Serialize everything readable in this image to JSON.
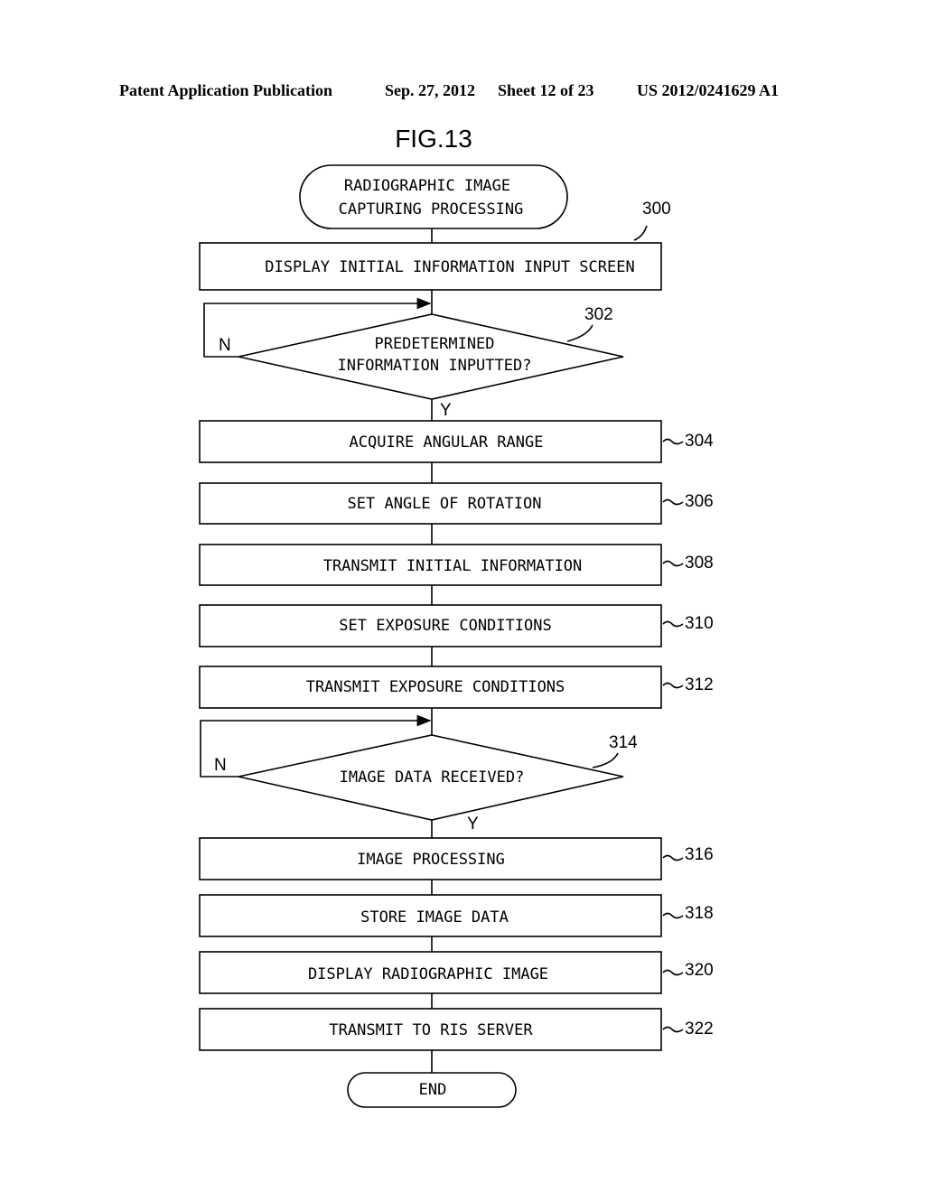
{
  "header": {
    "left": "Patent Application Publication",
    "date": "Sep. 27, 2012",
    "sheet": "Sheet 12 of 23",
    "number": "US 2012/0241629 A1"
  },
  "figure_title": "FIG.13",
  "start": {
    "line1": "RADIOGRAPHIC IMAGE",
    "line2": "CAPTURING PROCESSING"
  },
  "steps": [
    {
      "ref": "300",
      "label": "DISPLAY INITIAL INFORMATION INPUT SCREEN"
    },
    {
      "ref": "304",
      "label": "ACQUIRE ANGULAR RANGE"
    },
    {
      "ref": "306",
      "label": "SET ANGLE OF ROTATION"
    },
    {
      "ref": "308",
      "label": "TRANSMIT INITIAL INFORMATION"
    },
    {
      "ref": "310",
      "label": "SET EXPOSURE CONDITIONS"
    },
    {
      "ref": "312",
      "label": "TRANSMIT EXPOSURE CONDITIONS"
    },
    {
      "ref": "316",
      "label": "IMAGE PROCESSING"
    },
    {
      "ref": "318",
      "label": "STORE IMAGE DATA"
    },
    {
      "ref": "320",
      "label": "DISPLAY RADIOGRAPHIC IMAGE"
    },
    {
      "ref": "322",
      "label": "TRANSMIT TO RIS SERVER"
    }
  ],
  "decisions": [
    {
      "ref": "302",
      "line1": "PREDETERMINED",
      "line2": "INFORMATION INPUTTED?",
      "no": "N",
      "yes": "Y"
    },
    {
      "ref": "314",
      "line1": "IMAGE DATA RECEIVED?",
      "no": "N",
      "yes": "Y"
    }
  ],
  "end": "END"
}
